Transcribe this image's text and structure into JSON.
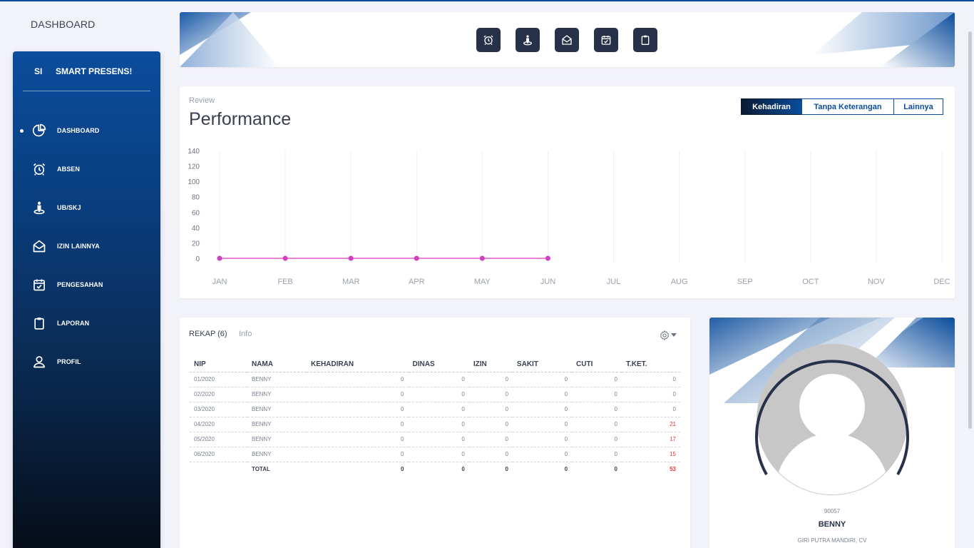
{
  "app": {
    "title": "DASHBOARD"
  },
  "sidebar": {
    "short": "SI",
    "title": "SMART PRESENS!",
    "items": [
      {
        "label": "DASHBOARD",
        "icon": "pie-chart-icon",
        "active": true
      },
      {
        "label": "ABSEN",
        "icon": "alarm-clock-icon",
        "active": false
      },
      {
        "label": "UB/SKJ",
        "icon": "person-location-icon",
        "active": false
      },
      {
        "label": "IZIN LAINNYA",
        "icon": "envelope-open-icon",
        "active": false
      },
      {
        "label": "PENGESAHAN",
        "icon": "calendar-check-icon",
        "active": false
      },
      {
        "label": "LAPORAN",
        "icon": "clipboard-icon",
        "active": false
      },
      {
        "label": "PROFIL",
        "icon": "user-icon",
        "active": false
      }
    ]
  },
  "quick_actions": [
    {
      "icon": "alarm-clock-icon"
    },
    {
      "icon": "person-location-icon"
    },
    {
      "icon": "envelope-open-icon"
    },
    {
      "icon": "calendar-check-icon"
    },
    {
      "icon": "clipboard-icon"
    }
  ],
  "performance": {
    "subtitle": "Review",
    "title": "Performance",
    "tabs": [
      {
        "label": "Kehadiran",
        "active": true
      },
      {
        "label": "Tanpa Keterangan",
        "active": false
      },
      {
        "label": "Lainnya",
        "active": false
      }
    ]
  },
  "chart_data": {
    "type": "line",
    "categories": [
      "JAN",
      "FEB",
      "MAR",
      "APR",
      "MAY",
      "JUN",
      "JUL",
      "AUG",
      "SEP",
      "OCT",
      "NOV",
      "DEC"
    ],
    "series": [
      {
        "values": [
          0,
          0,
          0,
          0,
          0,
          0
        ],
        "color": "#d63cc0"
      }
    ],
    "yticks": [
      0,
      20,
      40,
      60,
      80,
      100,
      120,
      140
    ],
    "ylim": [
      0,
      140
    ],
    "grid": "vertical"
  },
  "rekap": {
    "tabs": [
      {
        "label": "REKAP (6)"
      },
      {
        "label": "Info"
      }
    ],
    "columns": [
      "NIP",
      "NAMA",
      "KEHADIRAN",
      "DINAS",
      "IZIN",
      "SAKIT",
      "CUTI",
      "T.KET."
    ],
    "rows": [
      [
        "01/2020",
        "BENNY",
        "0",
        "0",
        "0",
        "0",
        "0",
        "0"
      ],
      [
        "02/2020",
        "BENNY",
        "0",
        "0",
        "0",
        "0",
        "0",
        "0"
      ],
      [
        "03/2020",
        "BENNY",
        "0",
        "0",
        "0",
        "0",
        "0",
        "0"
      ],
      [
        "04/2020",
        "BENNY",
        "0",
        "0",
        "0",
        "0",
        "0",
        "21"
      ],
      [
        "05/2020",
        "BENNY",
        "0",
        "0",
        "0",
        "0",
        "0",
        "17"
      ],
      [
        "06/2020",
        "BENNY",
        "0",
        "0",
        "0",
        "0",
        "0",
        "15"
      ]
    ],
    "total": [
      "",
      "TOTAL",
      "0",
      "0",
      "0",
      "0",
      "0",
      "53"
    ],
    "highlight_color": "#e53935"
  },
  "profile": {
    "nip": "90057",
    "name": "BENNY",
    "company": "GIRI PUTRA MANDIRI, CV"
  }
}
